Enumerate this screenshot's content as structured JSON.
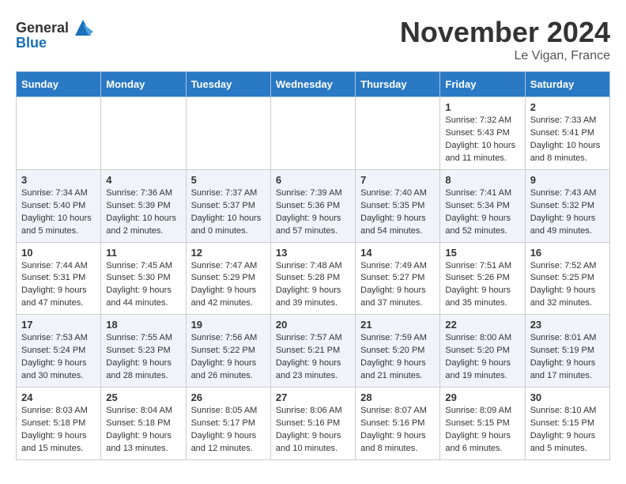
{
  "header": {
    "logo_general": "General",
    "logo_blue": "Blue",
    "month_title": "November 2024",
    "location": "Le Vigan, France"
  },
  "weekdays": [
    "Sunday",
    "Monday",
    "Tuesday",
    "Wednesday",
    "Thursday",
    "Friday",
    "Saturday"
  ],
  "weeks": [
    [
      {
        "day": "",
        "info": ""
      },
      {
        "day": "",
        "info": ""
      },
      {
        "day": "",
        "info": ""
      },
      {
        "day": "",
        "info": ""
      },
      {
        "day": "",
        "info": ""
      },
      {
        "day": "1",
        "info": "Sunrise: 7:32 AM\nSunset: 5:43 PM\nDaylight: 10 hours and 11 minutes."
      },
      {
        "day": "2",
        "info": "Sunrise: 7:33 AM\nSunset: 5:41 PM\nDaylight: 10 hours and 8 minutes."
      }
    ],
    [
      {
        "day": "3",
        "info": "Sunrise: 7:34 AM\nSunset: 5:40 PM\nDaylight: 10 hours and 5 minutes."
      },
      {
        "day": "4",
        "info": "Sunrise: 7:36 AM\nSunset: 5:39 PM\nDaylight: 10 hours and 2 minutes."
      },
      {
        "day": "5",
        "info": "Sunrise: 7:37 AM\nSunset: 5:37 PM\nDaylight: 10 hours and 0 minutes."
      },
      {
        "day": "6",
        "info": "Sunrise: 7:39 AM\nSunset: 5:36 PM\nDaylight: 9 hours and 57 minutes."
      },
      {
        "day": "7",
        "info": "Sunrise: 7:40 AM\nSunset: 5:35 PM\nDaylight: 9 hours and 54 minutes."
      },
      {
        "day": "8",
        "info": "Sunrise: 7:41 AM\nSunset: 5:34 PM\nDaylight: 9 hours and 52 minutes."
      },
      {
        "day": "9",
        "info": "Sunrise: 7:43 AM\nSunset: 5:32 PM\nDaylight: 9 hours and 49 minutes."
      }
    ],
    [
      {
        "day": "10",
        "info": "Sunrise: 7:44 AM\nSunset: 5:31 PM\nDaylight: 9 hours and 47 minutes."
      },
      {
        "day": "11",
        "info": "Sunrise: 7:45 AM\nSunset: 5:30 PM\nDaylight: 9 hours and 44 minutes."
      },
      {
        "day": "12",
        "info": "Sunrise: 7:47 AM\nSunset: 5:29 PM\nDaylight: 9 hours and 42 minutes."
      },
      {
        "day": "13",
        "info": "Sunrise: 7:48 AM\nSunset: 5:28 PM\nDaylight: 9 hours and 39 minutes."
      },
      {
        "day": "14",
        "info": "Sunrise: 7:49 AM\nSunset: 5:27 PM\nDaylight: 9 hours and 37 minutes."
      },
      {
        "day": "15",
        "info": "Sunrise: 7:51 AM\nSunset: 5:26 PM\nDaylight: 9 hours and 35 minutes."
      },
      {
        "day": "16",
        "info": "Sunrise: 7:52 AM\nSunset: 5:25 PM\nDaylight: 9 hours and 32 minutes."
      }
    ],
    [
      {
        "day": "17",
        "info": "Sunrise: 7:53 AM\nSunset: 5:24 PM\nDaylight: 9 hours and 30 minutes."
      },
      {
        "day": "18",
        "info": "Sunrise: 7:55 AM\nSunset: 5:23 PM\nDaylight: 9 hours and 28 minutes."
      },
      {
        "day": "19",
        "info": "Sunrise: 7:56 AM\nSunset: 5:22 PM\nDaylight: 9 hours and 26 minutes."
      },
      {
        "day": "20",
        "info": "Sunrise: 7:57 AM\nSunset: 5:21 PM\nDaylight: 9 hours and 23 minutes."
      },
      {
        "day": "21",
        "info": "Sunrise: 7:59 AM\nSunset: 5:20 PM\nDaylight: 9 hours and 21 minutes."
      },
      {
        "day": "22",
        "info": "Sunrise: 8:00 AM\nSunset: 5:20 PM\nDaylight: 9 hours and 19 minutes."
      },
      {
        "day": "23",
        "info": "Sunrise: 8:01 AM\nSunset: 5:19 PM\nDaylight: 9 hours and 17 minutes."
      }
    ],
    [
      {
        "day": "24",
        "info": "Sunrise: 8:03 AM\nSunset: 5:18 PM\nDaylight: 9 hours and 15 minutes."
      },
      {
        "day": "25",
        "info": "Sunrise: 8:04 AM\nSunset: 5:18 PM\nDaylight: 9 hours and 13 minutes."
      },
      {
        "day": "26",
        "info": "Sunrise: 8:05 AM\nSunset: 5:17 PM\nDaylight: 9 hours and 12 minutes."
      },
      {
        "day": "27",
        "info": "Sunrise: 8:06 AM\nSunset: 5:16 PM\nDaylight: 9 hours and 10 minutes."
      },
      {
        "day": "28",
        "info": "Sunrise: 8:07 AM\nSunset: 5:16 PM\nDaylight: 9 hours and 8 minutes."
      },
      {
        "day": "29",
        "info": "Sunrise: 8:09 AM\nSunset: 5:15 PM\nDaylight: 9 hours and 6 minutes."
      },
      {
        "day": "30",
        "info": "Sunrise: 8:10 AM\nSunset: 5:15 PM\nDaylight: 9 hours and 5 minutes."
      }
    ]
  ]
}
